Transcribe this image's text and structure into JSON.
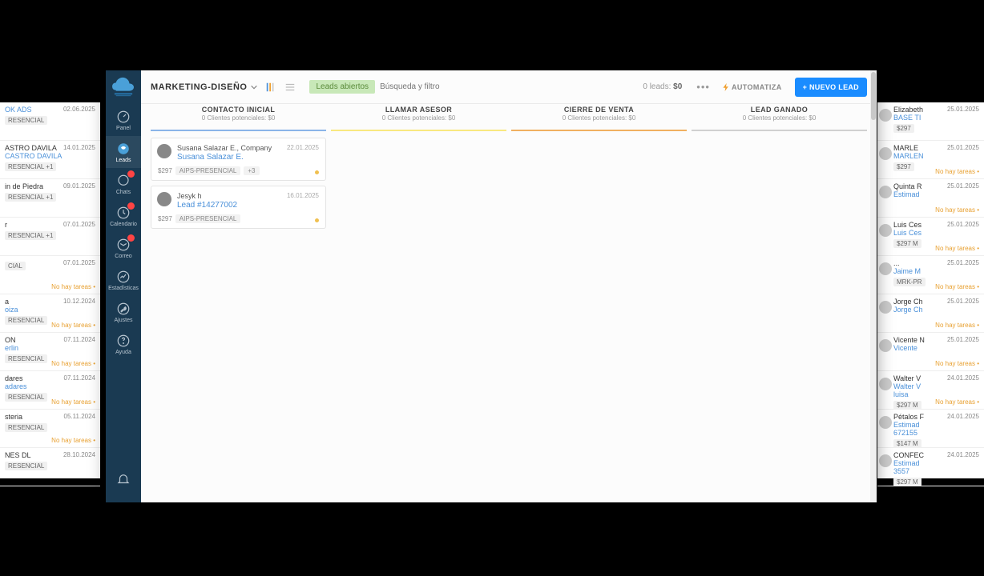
{
  "sidebar": {
    "logo_alt": "SITIOCAPA",
    "items": [
      {
        "label": "Panel",
        "icon": "gauge"
      },
      {
        "label": "Leads",
        "icon": "lead",
        "active": true
      },
      {
        "label": "Chats",
        "icon": "chat",
        "badge": true
      },
      {
        "label": "Calendario",
        "icon": "calendar",
        "badge": true
      },
      {
        "label": "Correo",
        "icon": "mail",
        "badge": true
      },
      {
        "label": "Estadísticas",
        "icon": "stats"
      },
      {
        "label": "Ajustes",
        "icon": "wrench"
      },
      {
        "label": "Ayuda",
        "icon": "help"
      }
    ],
    "bottom_icon": "bell"
  },
  "topbar": {
    "pipeline": "MARKETING-DISEÑO",
    "filter_pill": "Leads abiertos",
    "search_placeholder": "Búsqueda y filtro",
    "leads_count_prefix": "0 leads:",
    "leads_count_amount": "$0",
    "automate": "AUTOMATIZA",
    "new_lead": "+ NUEVO LEAD"
  },
  "stages": [
    {
      "title": "CONTACTO INICIAL",
      "sub": "0 Clientes potenciales: $0"
    },
    {
      "title": "LLAMAR ASESOR",
      "sub": "0 Clientes potenciales: $0"
    },
    {
      "title": "CIERRE DE VENTA",
      "sub": "0 Clientes potenciales: $0"
    },
    {
      "title": "LEAD GANADO",
      "sub": "0 Clientes potenciales: $0"
    }
  ],
  "leads": [
    {
      "name": "Susana Salazar E., Company",
      "title": "Susana Salazar E.",
      "date": "22.01.2025",
      "price": "$297",
      "tags": [
        "AIPS-PRESENCIAL",
        "+3"
      ]
    },
    {
      "name": "Jesyk h",
      "title": "Lead #14277002",
      "date": "16.01.2025",
      "price": "$297",
      "tags": [
        "AIPS-PRESENCIAL"
      ]
    }
  ],
  "bg_left": [
    {
      "l1": "",
      "l2": "OK ADS",
      "date": "02.06.2025",
      "tag": "RESENCIAL",
      "nohay": ""
    },
    {
      "l1": "ASTRO DAVILA",
      "l2": "CASTRO DAVILA",
      "date": "14.01.2025",
      "tag": "RESENCIAL  +1",
      "nohay": ""
    },
    {
      "l1": "in de Piedra",
      "l2": "",
      "date": "09.01.2025",
      "tag": "RESENCIAL  +1",
      "nohay": ""
    },
    {
      "l1": "r",
      "l2": "",
      "date": "07.01.2025",
      "tag": "RESENCIAL  +1",
      "nohay": ""
    },
    {
      "l1": "",
      "l2": "",
      "date": "07.01.2025",
      "tag": "CIAL",
      "nohay": "No hay tareas •"
    },
    {
      "l1": "a",
      "l2": "oiza",
      "date": "10.12.2024",
      "tag": "RESENCIAL",
      "nohay": "No hay tareas •"
    },
    {
      "l1": "ON",
      "l2": "erlin",
      "date": "07.11.2024",
      "tag": "RESENCIAL",
      "nohay": "No hay tareas •"
    },
    {
      "l1": "dares",
      "l2": "adares",
      "date": "07.11.2024",
      "tag": "RESENCIAL",
      "nohay": "No hay tareas •"
    },
    {
      "l1": "steria",
      "l2": "",
      "date": "05.11.2024",
      "tag": "RESENCIAL",
      "nohay": "No hay tareas •"
    },
    {
      "l1": "NES DL",
      "l2": "",
      "date": "28.10.2024",
      "tag": "RESENCIAL",
      "nohay": ""
    }
  ],
  "bg_right": [
    {
      "l1": "Elizabeth",
      "l2": "BASE TI",
      "date": "25.01.2025",
      "meta": "$297",
      "nohay": ""
    },
    {
      "l1": "MARLE",
      "l2": "MARLEN",
      "date": "25.01.2025",
      "meta": "$297",
      "nohay": "No hay tareas •"
    },
    {
      "l1": "Quinta R",
      "l2": "Estimad",
      "date": "25.01.2025",
      "meta": "",
      "nohay": "No hay tareas •"
    },
    {
      "l1": "Luis Ces",
      "l2": "Luis Ces",
      "date": "25.01.2025",
      "meta": "$297  M",
      "nohay": "No hay tareas •"
    },
    {
      "l1": "...",
      "l2": "Jaime M",
      "date": "25.01.2025",
      "meta": "MRK-PR",
      "nohay": "No hay tareas •"
    },
    {
      "l1": "Jorge Ch",
      "l2": "Jorge Ch",
      "date": "25.01.2025",
      "meta": "",
      "nohay": "No hay tareas •"
    },
    {
      "l1": "Vicente N",
      "l2": "Vicente",
      "date": "25.01.2025",
      "meta": "",
      "nohay": "No hay tareas •"
    },
    {
      "l1": "Walter V",
      "l2": "Walter V",
      "date": "24.01.2025",
      "meta": "$297  M",
      "nohay": "No hay tareas •",
      "extra": "luisa"
    },
    {
      "l1": "Pétalos F",
      "l2": "Estimad",
      "date": "24.01.2025",
      "meta": "$147  M",
      "nohay": "",
      "extra": "672155"
    },
    {
      "l1": "CONFEC",
      "l2": "Estimad",
      "date": "24.01.2025",
      "meta": "$297  M",
      "nohay": "",
      "extra": "3557"
    }
  ]
}
